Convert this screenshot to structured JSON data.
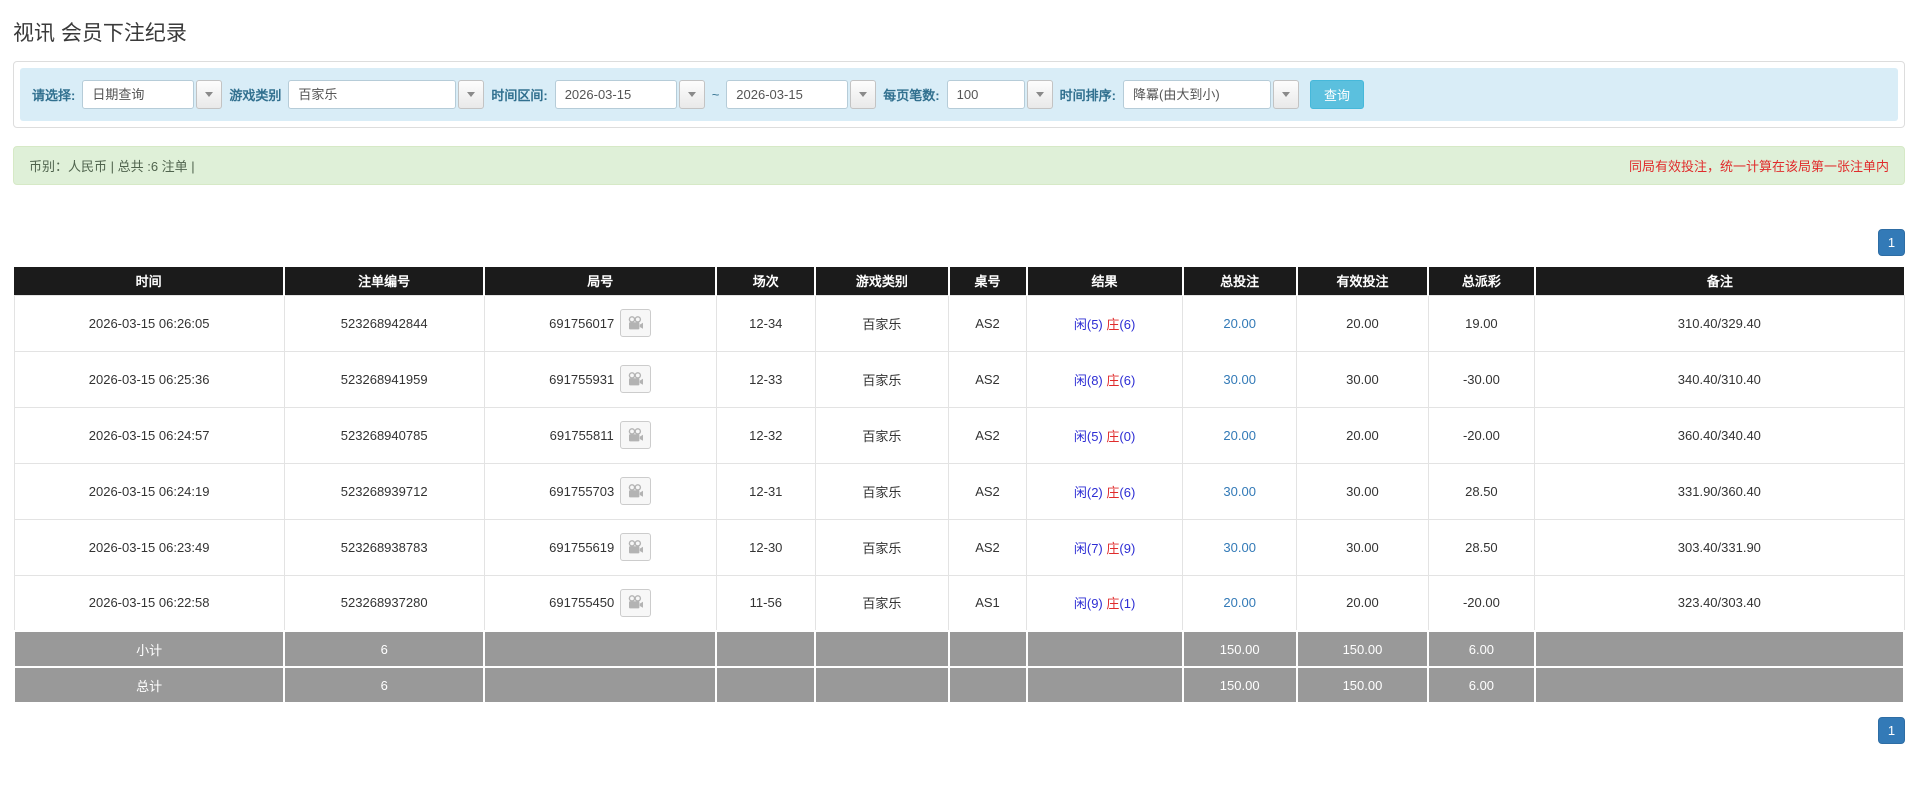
{
  "title": "视讯 会员下注纪录",
  "filter": {
    "select_label": "请选择:",
    "select_value": "日期查询",
    "game_label": "游戏类别",
    "game_value": "百家乐",
    "range_label": "时间区间:",
    "date_from": "2026-03-15",
    "tilde": "~",
    "date_to": "2026-03-15",
    "per_page_label": "每页笔数:",
    "per_page_value": "100",
    "sort_label": "时间排序:",
    "sort_value": "降冪(由大到小)",
    "search_label": "查询"
  },
  "summary": {
    "currency_info": "币别：人民币 | 总共 :6 注单 |",
    "notice": "同局有效投注，统一计算在该局第一张注单内"
  },
  "pagination": {
    "page": "1"
  },
  "table": {
    "headers": [
      "时间",
      "注单编号",
      "局号",
      "场次",
      "游戏类别",
      "桌号",
      "结果",
      "总投注",
      "有效投注",
      "总派彩",
      "备注"
    ],
    "col_widths": [
      "14.2%",
      "10.5%",
      "12.2%",
      "5.2%",
      "7%",
      "4.1%",
      "8.2%",
      "6%",
      "6.9%",
      "5.6%",
      "19.4%"
    ],
    "rows": [
      {
        "time": "2026-03-15 06:26:05",
        "bet_id": "523268942844",
        "round_id": "691756017",
        "session": "12-34",
        "game": "百家乐",
        "table_id": "AS2",
        "result": {
          "player_label": "闲",
          "player_score": "(5)",
          "banker_label": "庄",
          "banker_score": "(6)"
        },
        "total_bet": "20.00",
        "valid_bet": "20.00",
        "payout": "19.00",
        "remark": "310.40/329.40"
      },
      {
        "time": "2026-03-15 06:25:36",
        "bet_id": "523268941959",
        "round_id": "691755931",
        "session": "12-33",
        "game": "百家乐",
        "table_id": "AS2",
        "result": {
          "player_label": "闲",
          "player_score": "(8)",
          "banker_label": "庄",
          "banker_score": "(6)"
        },
        "total_bet": "30.00",
        "valid_bet": "30.00",
        "payout": "-30.00",
        "remark": "340.40/310.40"
      },
      {
        "time": "2026-03-15 06:24:57",
        "bet_id": "523268940785",
        "round_id": "691755811",
        "session": "12-32",
        "game": "百家乐",
        "table_id": "AS2",
        "result": {
          "player_label": "闲",
          "player_score": "(5)",
          "banker_label": "庄",
          "banker_score": "(0)"
        },
        "total_bet": "20.00",
        "valid_bet": "20.00",
        "payout": "-20.00",
        "remark": "360.40/340.40"
      },
      {
        "time": "2026-03-15 06:24:19",
        "bet_id": "523268939712",
        "round_id": "691755703",
        "session": "12-31",
        "game": "百家乐",
        "table_id": "AS2",
        "result": {
          "player_label": "闲",
          "player_score": "(2)",
          "banker_label": "庄",
          "banker_score": "(6)"
        },
        "total_bet": "30.00",
        "valid_bet": "30.00",
        "payout": "28.50",
        "remark": "331.90/360.40"
      },
      {
        "time": "2026-03-15 06:23:49",
        "bet_id": "523268938783",
        "round_id": "691755619",
        "session": "12-30",
        "game": "百家乐",
        "table_id": "AS2",
        "result": {
          "player_label": "闲",
          "player_score": "(7)",
          "banker_label": "庄",
          "banker_score": "(9)"
        },
        "total_bet": "30.00",
        "valid_bet": "30.00",
        "payout": "28.50",
        "remark": "303.40/331.90"
      },
      {
        "time": "2026-03-15 06:22:58",
        "bet_id": "523268937280",
        "round_id": "691755450",
        "session": "11-56",
        "game": "百家乐",
        "table_id": "AS1",
        "result": {
          "player_label": "闲",
          "player_score": "(9)",
          "banker_label": "庄",
          "banker_score": "(1)"
        },
        "total_bet": "20.00",
        "valid_bet": "20.00",
        "payout": "-20.00",
        "remark": "323.40/303.40"
      }
    ],
    "subtotal_row": {
      "label": "小计",
      "count": "6",
      "total_bet": "150.00",
      "valid_bet": "150.00",
      "payout": "6.00"
    },
    "total_row": {
      "label": "总计",
      "count": "6",
      "total_bet": "150.00",
      "valid_bet": "150.00",
      "payout": "6.00"
    }
  },
  "colors": {
    "filter_bg": "#d9edf7",
    "summary_bg": "#dff0d8",
    "header_bg": "#1b1b1b",
    "total_row_bg": "#999999",
    "accent_blue": "#337ab7",
    "search_button_blue": "#5bc0de",
    "negative_red": "#e02c2c",
    "result_player_blue": "#2d2dd4",
    "result_banker_red": "#e02c2c"
  }
}
